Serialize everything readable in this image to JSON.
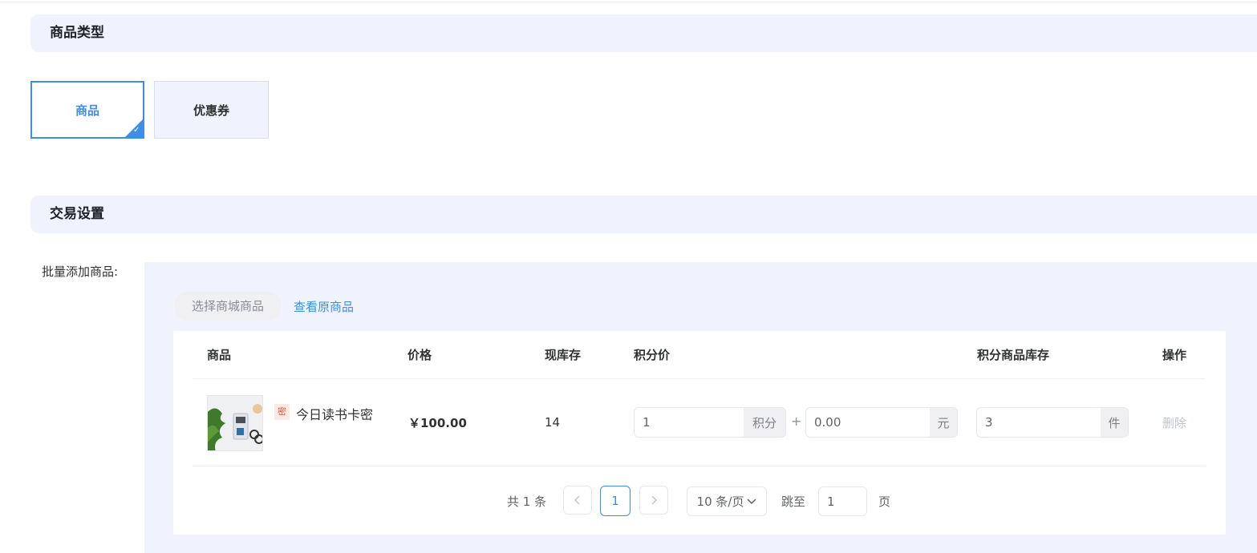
{
  "sections": {
    "type_title": "商品类型",
    "trade_title": "交易设置"
  },
  "goods_type": {
    "options": [
      {
        "label": "商品",
        "selected": true
      },
      {
        "label": "优惠券",
        "selected": false
      }
    ],
    "accent_color": "#3f8ee6"
  },
  "batch": {
    "label": "批量添加商品:",
    "select_button": "选择商城商品",
    "view_link": "查看原商品"
  },
  "table": {
    "headers": [
      "商品",
      "价格",
      "现库存",
      "积分价",
      "积分商品库存",
      "操作"
    ],
    "rows": [
      {
        "tag": "密",
        "name": "今日读书卡密",
        "price": "￥100.00",
        "stock": "14",
        "points": "1",
        "points_unit": "积分",
        "plus": "+",
        "cash": "0.00",
        "cash_unit": "元",
        "points_stock": "3",
        "points_stock_unit": "件",
        "action": "删除"
      }
    ]
  },
  "pagination": {
    "total": "共 1 条",
    "current_page": "1",
    "page_size": "10 条/页",
    "jump_label": "跳至",
    "jump_value": "1",
    "page_unit": "页",
    "icons": {
      "prev": "chevron-left-icon",
      "next": "chevron-right-icon",
      "dropdown": "chevron-down-icon"
    }
  }
}
